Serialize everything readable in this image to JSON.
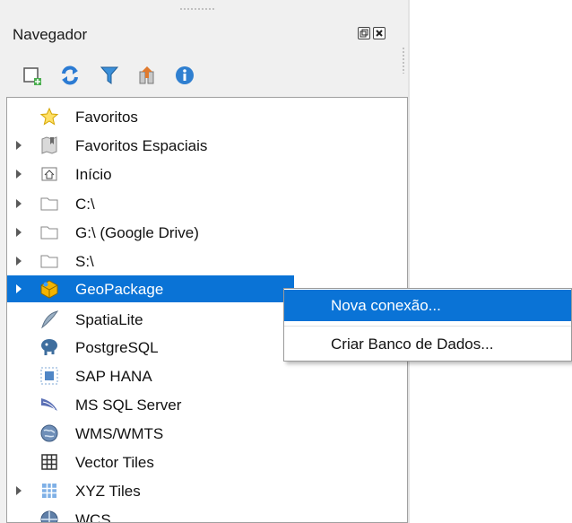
{
  "panel": {
    "title": "Navegador"
  },
  "toolbar": {
    "items": [
      "add-layer-icon",
      "refresh-icon",
      "filter-icon",
      "collapse-all-icon",
      "properties-icon"
    ]
  },
  "tree": {
    "items": [
      {
        "label": "Favoritos",
        "icon": "star-icon",
        "expandable": false
      },
      {
        "label": "Favoritos Espaciais",
        "icon": "spatial-bookmarks-icon",
        "expandable": true
      },
      {
        "label": "Início",
        "icon": "home-folder-icon",
        "expandable": true
      },
      {
        "label": "C:\\",
        "icon": "folder-icon",
        "expandable": true
      },
      {
        "label": "G:\\ (Google Drive)",
        "icon": "folder-icon",
        "expandable": true
      },
      {
        "label": "S:\\",
        "icon": "folder-icon",
        "expandable": true
      },
      {
        "label": "GeoPackage",
        "icon": "geopackage-icon",
        "expandable": true,
        "selected": true
      },
      {
        "label": "SpatiaLite",
        "icon": "spatialite-icon",
        "expandable": false
      },
      {
        "label": "PostgreSQL",
        "icon": "postgresql-icon",
        "expandable": false
      },
      {
        "label": "SAP HANA",
        "icon": "sap-hana-icon",
        "expandable": false
      },
      {
        "label": "MS SQL Server",
        "icon": "mssql-icon",
        "expandable": false
      },
      {
        "label": "WMS/WMTS",
        "icon": "wms-icon",
        "expandable": false
      },
      {
        "label": "Vector Tiles",
        "icon": "vector-tiles-icon",
        "expandable": false
      },
      {
        "label": "XYZ Tiles",
        "icon": "xyz-tiles-icon",
        "expandable": true
      },
      {
        "label": "WCS",
        "icon": "wcs-icon",
        "expandable": false
      }
    ]
  },
  "context_menu": {
    "items": [
      {
        "label": "Nova conexão...",
        "highlighted": true
      },
      {
        "label": "Criar Banco de Dados...",
        "highlighted": false
      }
    ]
  },
  "colors": {
    "selection": "#0a73d6",
    "panel_bg": "#f0f0f0"
  }
}
